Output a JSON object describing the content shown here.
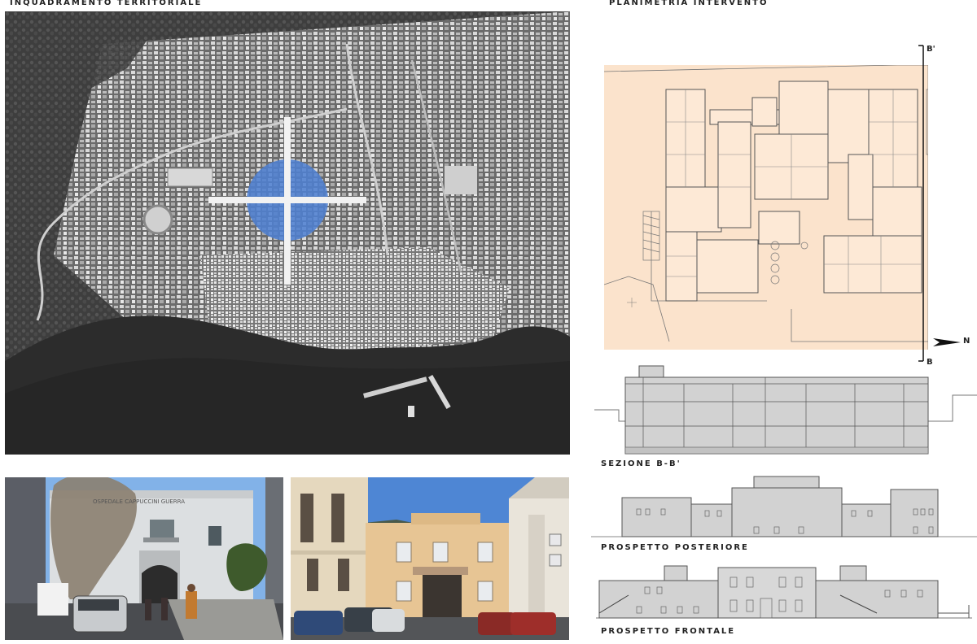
{
  "labels": {
    "site_title": "INQUADRAMENTO TERRITORIALE",
    "plan_title": "PLANIMETRIA INTERVENTO",
    "section_title": "SEZIONE B-B'",
    "rear_title": "PROSPETTO POSTERIORE",
    "front_title": "PROSPETTO FRONTALE"
  },
  "plan": {
    "section_top": "B'",
    "section_bottom": "B",
    "north": "N",
    "background_color": "#fbe3cc"
  },
  "photo1": {
    "sign": "OSPEDALE CAPPUCCINI GUERRA"
  },
  "marker": {
    "color": "#4f7fd0"
  }
}
